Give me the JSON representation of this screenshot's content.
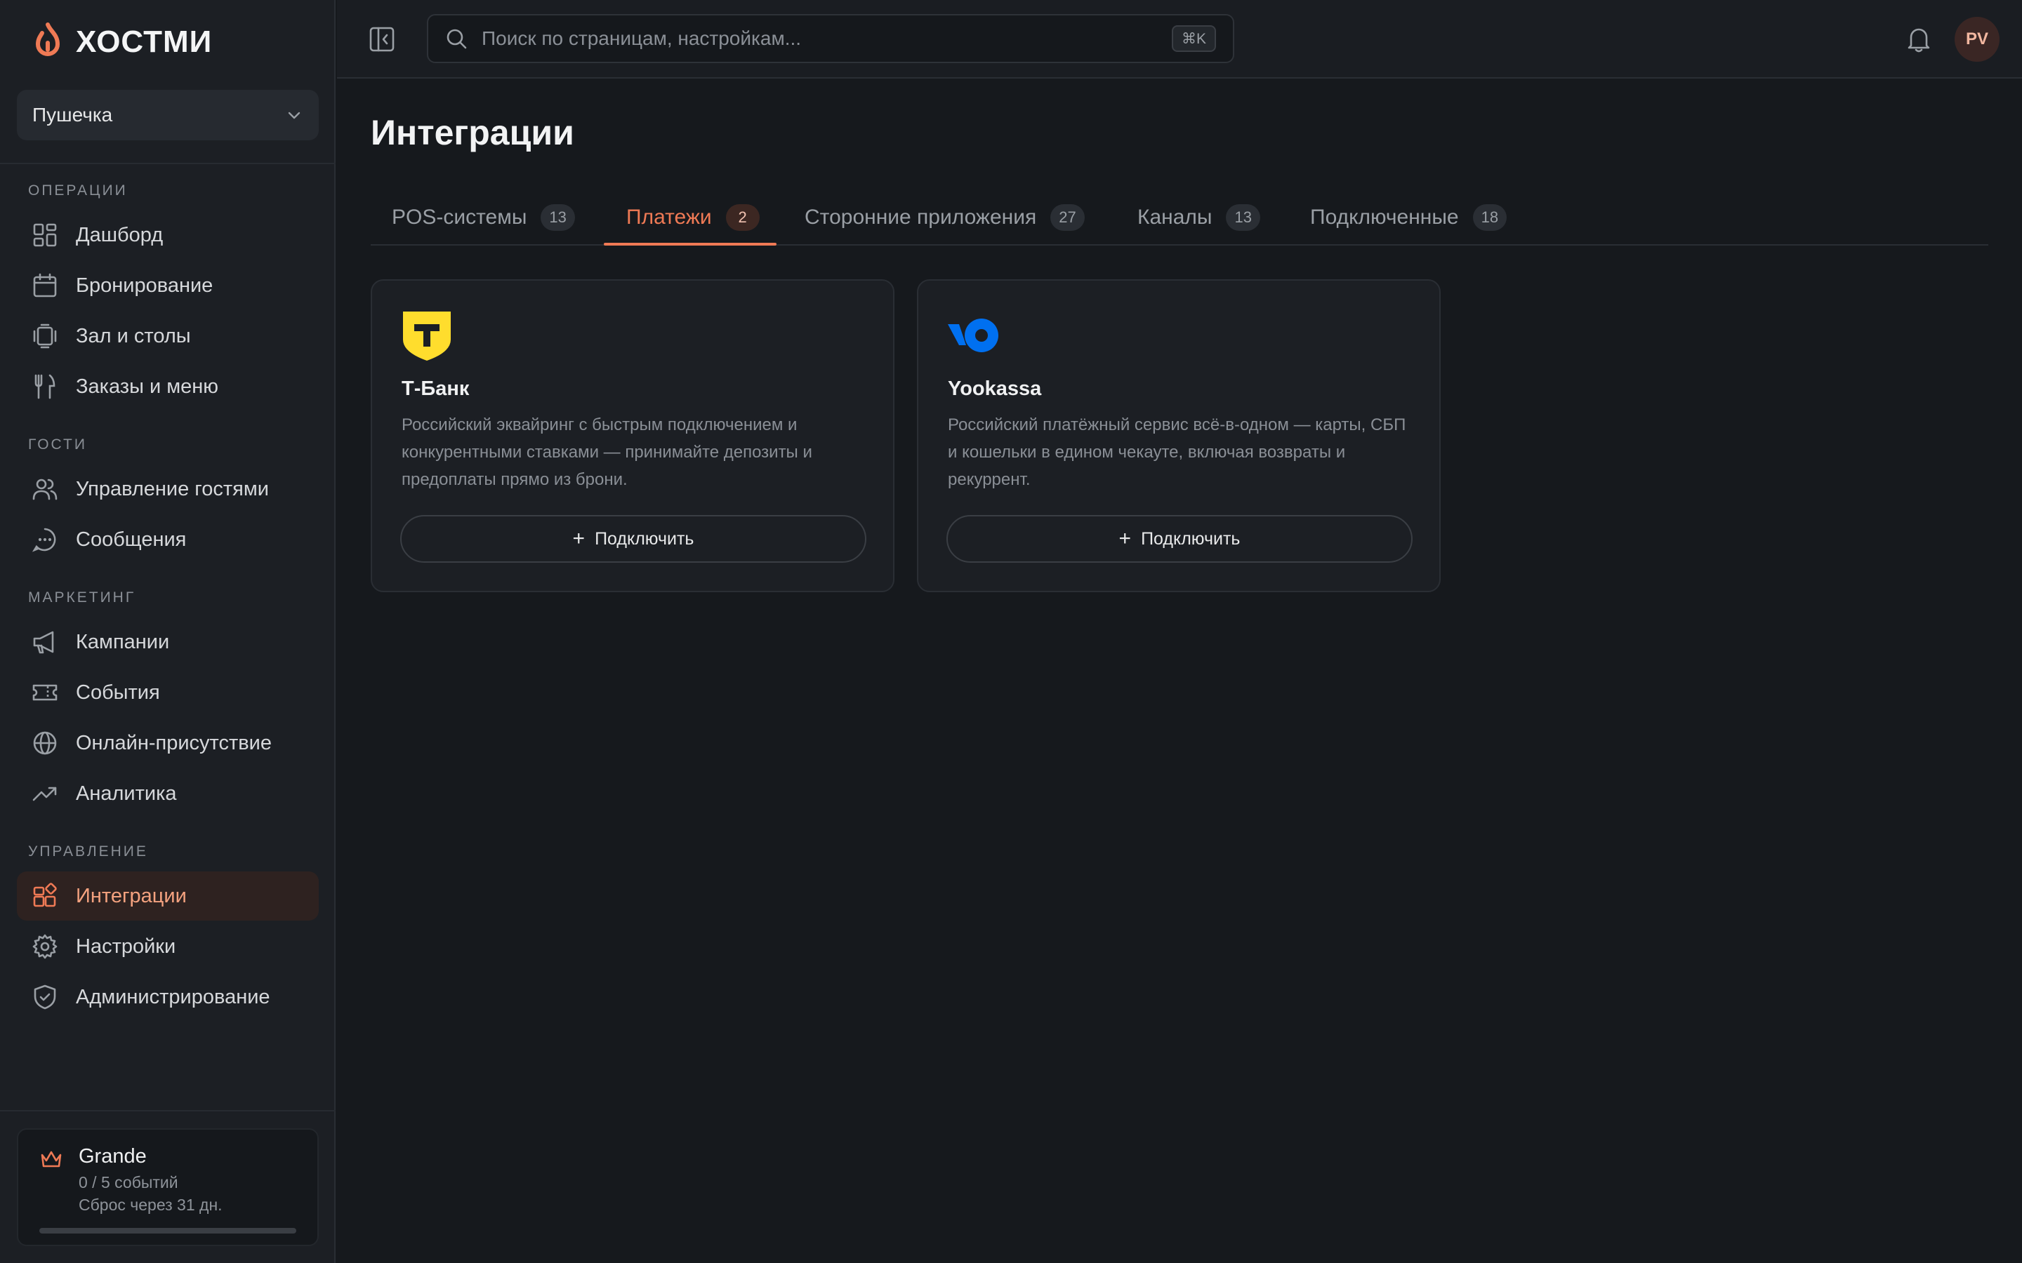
{
  "brand": {
    "name": "ХОСТМИ",
    "accent": "#ef7a55"
  },
  "venue": {
    "name": "Пушечка"
  },
  "nav": {
    "sections": [
      {
        "title": "ОПЕРАЦИИ"
      },
      {
        "title": "ГОСТИ"
      },
      {
        "title": "МАРКЕТИНГ"
      },
      {
        "title": "УПРАВЛЕНИЕ"
      }
    ],
    "items": [
      {
        "label": "Дашборд",
        "icon": "dashboard-icon"
      },
      {
        "label": "Бронирование",
        "icon": "calendar-icon"
      },
      {
        "label": "Зал и столы",
        "icon": "table-icon"
      },
      {
        "label": "Заказы и меню",
        "icon": "cutlery-icon"
      },
      {
        "label": "Управление гостями",
        "icon": "users-icon"
      },
      {
        "label": "Сообщения",
        "icon": "chat-icon"
      },
      {
        "label": "Кампании",
        "icon": "megaphone-icon"
      },
      {
        "label": "События",
        "icon": "ticket-icon"
      },
      {
        "label": "Онлайн-присутствие",
        "icon": "globe-icon"
      },
      {
        "label": "Аналитика",
        "icon": "trend-icon"
      },
      {
        "label": "Интеграции",
        "icon": "integrations-icon",
        "active": true
      },
      {
        "label": "Настройки",
        "icon": "gear-icon"
      },
      {
        "label": "Администрирование",
        "icon": "shield-icon"
      }
    ]
  },
  "plan": {
    "name": "Grande",
    "usage": "0 / 5 событий",
    "reset": "Сброс через 31 дн.",
    "progress": 0
  },
  "topbar": {
    "search_placeholder": "Поиск по страницам, настройкам...",
    "shortcut": "⌘K",
    "avatar_initials": "PV"
  },
  "page": {
    "title": "Интеграции"
  },
  "tabs": [
    {
      "label": "POS-системы",
      "count": "13"
    },
    {
      "label": "Платежи",
      "count": "2",
      "active": true
    },
    {
      "label": "Сторонние приложения",
      "count": "27"
    },
    {
      "label": "Каналы",
      "count": "13"
    },
    {
      "label": "Подключенные",
      "count": "18"
    }
  ],
  "cards": [
    {
      "name": "Т-Банк",
      "description": "Российский эквайринг с быстрым подключением и конкурентными ставками — принимайте депозиты и предоплаты прямо из брони.",
      "button": "Подключить",
      "logo": "tbank-logo",
      "logo_color": "#ffdd2d"
    },
    {
      "name": "Yookassa",
      "description": "Российский платёжный сервис всё-в-одном — карты, СБП и кошельки в едином чекауте, включая возвраты и рекуррент.",
      "button": "Подключить",
      "logo": "yookassa-logo",
      "logo_color": "#0070f0"
    }
  ]
}
